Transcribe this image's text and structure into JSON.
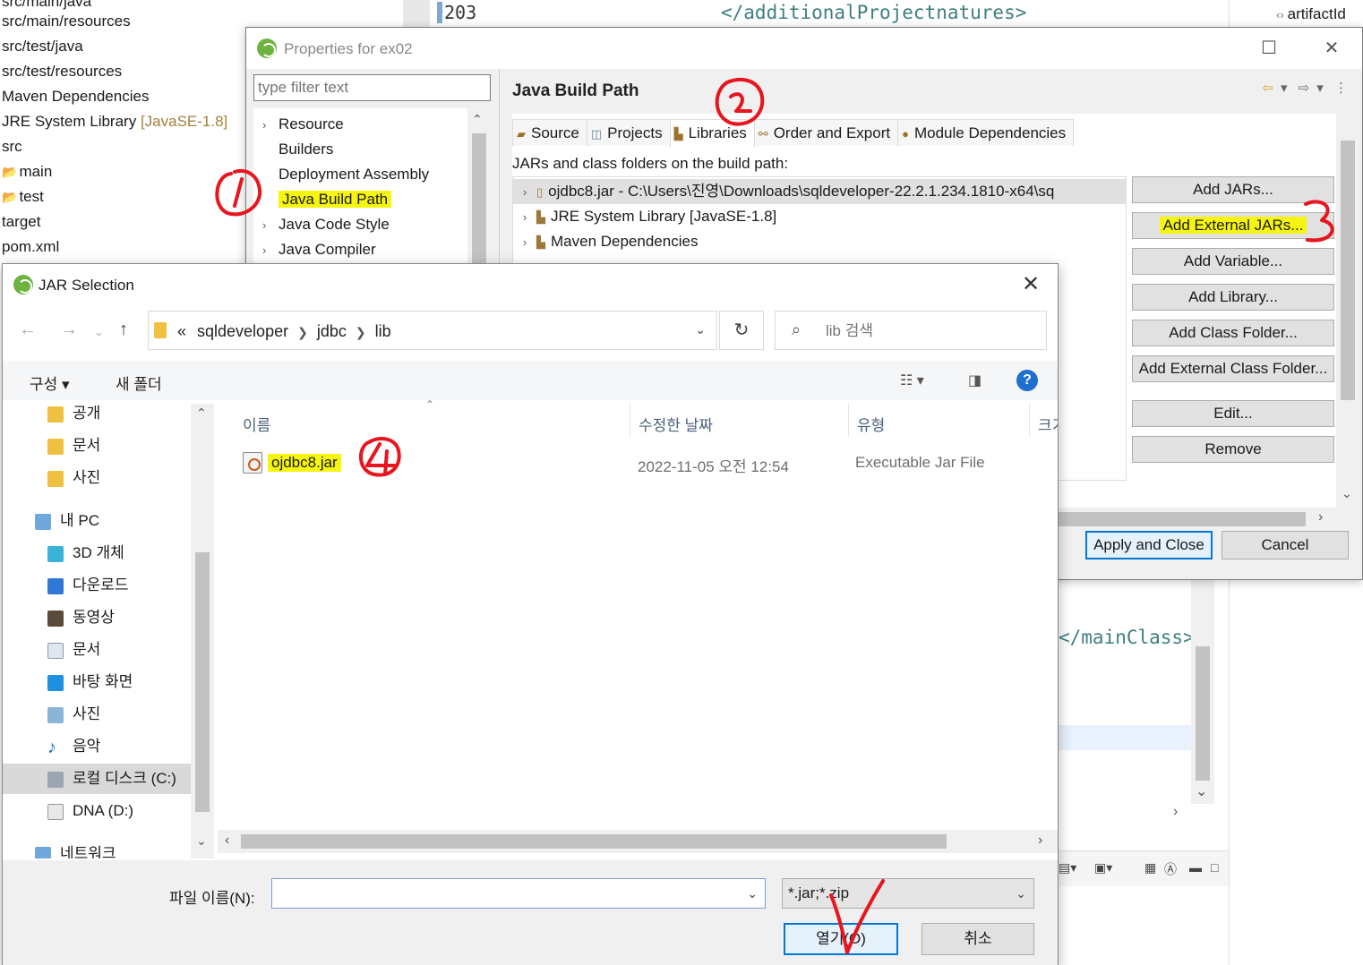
{
  "package_explorer": {
    "items": [
      "src/main/java",
      "src/main/resources",
      "src/test/java",
      "src/test/resources",
      "Maven Dependencies",
      "JRE System Library",
      "src",
      "main",
      "test",
      "target",
      "pom.xml"
    ],
    "jre_suffix": "[JavaSE-1.8]"
  },
  "editor": {
    "line_number": "203",
    "line_code": "</additionalProjectnatures>",
    "lower_code": "</mainClass>"
  },
  "outline": {
    "item": "artifactId"
  },
  "properties_dialog": {
    "title": "Properties for ex02",
    "filter_placeholder": "type filter text",
    "tree": [
      "Resource",
      "Builders",
      "Deployment Assembly",
      "Java Build Path",
      "Java Code Style",
      "Java Compiler"
    ],
    "page_title": "Java Build Path",
    "tabs": [
      "Source",
      "Projects",
      "Libraries",
      "Order and Export",
      "Module Dependencies"
    ],
    "list_label": "JARs and class folders on the build path:",
    "entries": [
      "ojdbc8.jar - C:\\Users\\진영\\Downloads\\sqldeveloper-22.2.1.234.1810-x64\\sq",
      "JRE System Library [JavaSE-1.8]",
      "Maven Dependencies"
    ],
    "buttons": [
      "Add JARs...",
      "Add External JARs...",
      "Add Variable...",
      "Add Library...",
      "Add Class Folder...",
      "Add External Class Folder...",
      "Edit...",
      "Remove"
    ],
    "apply_close": "Apply and Close",
    "cancel": "Cancel"
  },
  "jar_dialog": {
    "title": "JAR Selection",
    "path_prefix": "«",
    "path": [
      "sqldeveloper",
      "jdbc",
      "lib"
    ],
    "search_placeholder": "lib 검색",
    "toolbar_organize": "구성 ▾",
    "toolbar_new_folder": "새 폴더",
    "nav_items": [
      "공개",
      "문서",
      "사진",
      "내 PC",
      "3D 개체",
      "다운로드",
      "동영상",
      "문서",
      "바탕 화면",
      "사진",
      "음악",
      "로컬 디스크 (C:)",
      "DNA (D:)",
      "네트워크"
    ],
    "columns": [
      "이름",
      "수정한 날짜",
      "유형",
      "크기"
    ],
    "file": {
      "name": "ojdbc8.jar",
      "modified": "2022-11-05 오전 12:54",
      "type": "Executable Jar File"
    },
    "filename_label": "파일 이름(N):",
    "filename_value": "",
    "filter_value": "*.jar;*.zip",
    "open_label": "열기(O)",
    "cancel_label": "취소"
  },
  "colors": {
    "highlight": "#f5f50f",
    "annotation_red": "#e8141e",
    "accent_blue": "#0078d7"
  }
}
